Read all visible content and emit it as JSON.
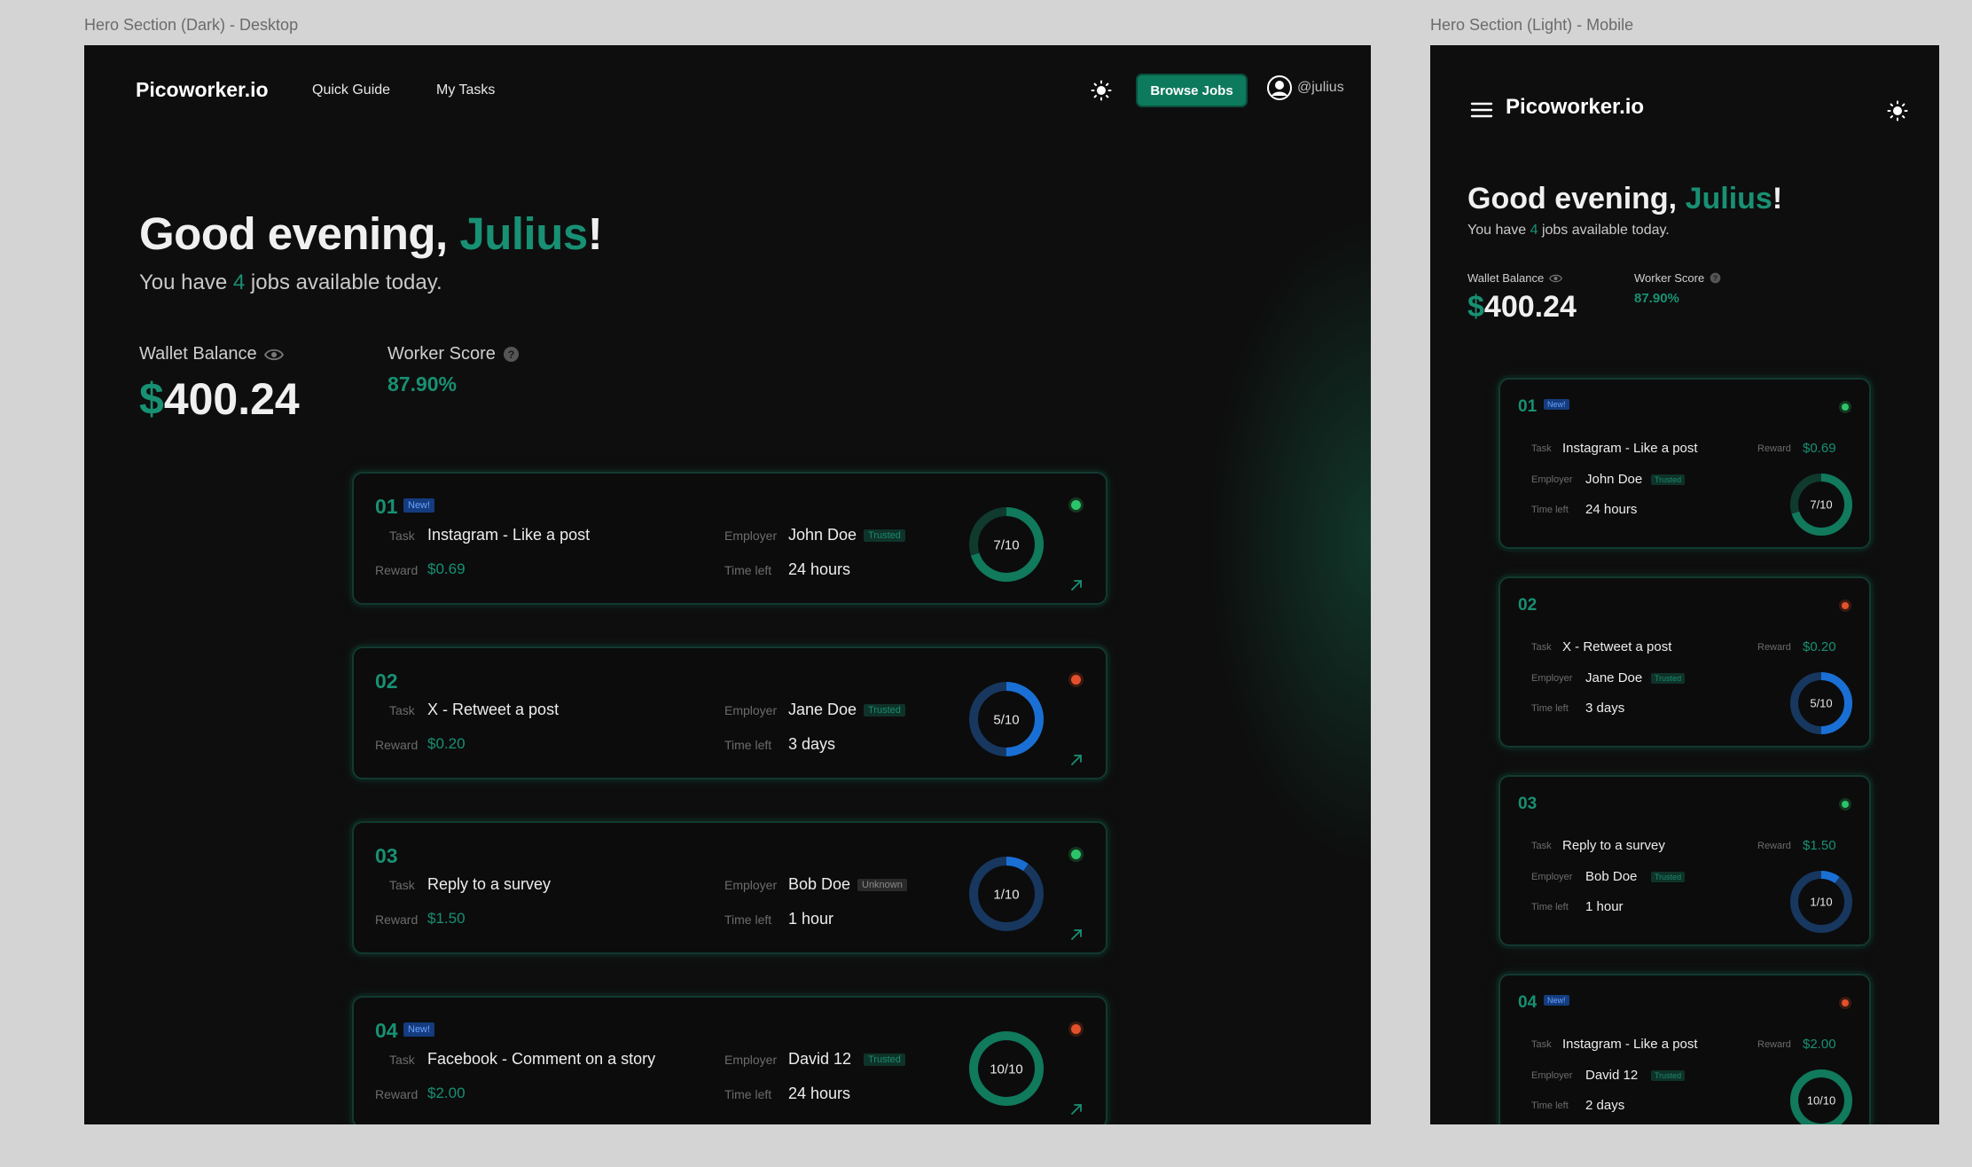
{
  "labels": {
    "desktop_frame": "Hero Section (Dark) - Desktop",
    "mobile_frame": "Hero Section (Light) - Mobile"
  },
  "nav": {
    "logo": "Picoworker.io",
    "quick_guide": "Quick Guide",
    "my_tasks": "My Tasks",
    "browse_jobs": "Browse Jobs",
    "username": "@julius"
  },
  "hero": {
    "greeting_prefix": "Good evening, ",
    "name": "Julius",
    "greeting_suffix": "!",
    "sub_prefix": "You have ",
    "jobs_count": "4",
    "sub_suffix": " jobs available today.",
    "wallet_label": "Wallet Balance",
    "wallet_currency": "$",
    "wallet_amount": "400.24",
    "score_label": "Worker Score",
    "score_value": "87.90%"
  },
  "field_labels": {
    "task": "Task",
    "reward": "Reward",
    "employer": "Employer",
    "time_left": "Time left"
  },
  "new_badge": "New!",
  "colors": {
    "accent": "#189073",
    "bg": "#0e0e0e",
    "ring_green": "#11795c",
    "ring_blue": "#1a6fd4",
    "status_green": "#2bc46a",
    "status_red": "#e2502c"
  },
  "desktop_jobs": [
    {
      "num": "01",
      "is_new": true,
      "task": "Instagram - Like a post",
      "reward": "$0.69",
      "employer": "John Doe",
      "employer_tag": "Trusted",
      "time_left": "24 hours",
      "progress_text": "7/10",
      "progress": 0.7,
      "ring_color": "green",
      "status": "green"
    },
    {
      "num": "02",
      "is_new": false,
      "task": "X - Retweet a post",
      "reward": "$0.20",
      "employer": "Jane Doe",
      "employer_tag": "Trusted",
      "time_left": "3 days",
      "progress_text": "5/10",
      "progress": 0.5,
      "ring_color": "blue",
      "status": "red"
    },
    {
      "num": "03",
      "is_new": false,
      "task": "Reply to a survey",
      "reward": "$1.50",
      "employer": "Bob Doe",
      "employer_tag": "Unknown",
      "time_left": "1 hour",
      "progress_text": "1/10",
      "progress": 0.1,
      "ring_color": "blue",
      "status": "green"
    },
    {
      "num": "04",
      "is_new": true,
      "task": "Facebook - Comment on a story",
      "reward": "$2.00",
      "employer": "David 12",
      "employer_tag": "Trusted",
      "time_left": "24 hours",
      "progress_text": "10/10",
      "progress": 1.0,
      "ring_color": "green",
      "status": "red"
    }
  ],
  "mobile_jobs": [
    {
      "num": "01",
      "is_new": true,
      "task": "Instagram - Like a post",
      "reward": "$0.69",
      "employer": "John Doe",
      "employer_tag": "Trusted",
      "time_left": "24 hours",
      "progress_text": "7/10",
      "progress": 0.7,
      "ring_color": "green",
      "status": "green"
    },
    {
      "num": "02",
      "is_new": false,
      "task": "X - Retweet a post",
      "reward": "$0.20",
      "employer": "Jane Doe",
      "employer_tag": "Trusted",
      "time_left": "3 days",
      "progress_text": "5/10",
      "progress": 0.5,
      "ring_color": "blue",
      "status": "red"
    },
    {
      "num": "03",
      "is_new": false,
      "task": "Reply to a survey",
      "reward": "$1.50",
      "employer": "Bob Doe",
      "employer_tag": "Trusted",
      "time_left": "1 hour",
      "progress_text": "1/10",
      "progress": 0.1,
      "ring_color": "blue",
      "status": "green"
    },
    {
      "num": "04",
      "is_new": true,
      "task": "Instagram - Like a post",
      "reward": "$2.00",
      "employer": "David 12",
      "employer_tag": "Trusted",
      "time_left": "2 days",
      "progress_text": "10/10",
      "progress": 1.0,
      "ring_color": "green",
      "status": "red"
    }
  ]
}
